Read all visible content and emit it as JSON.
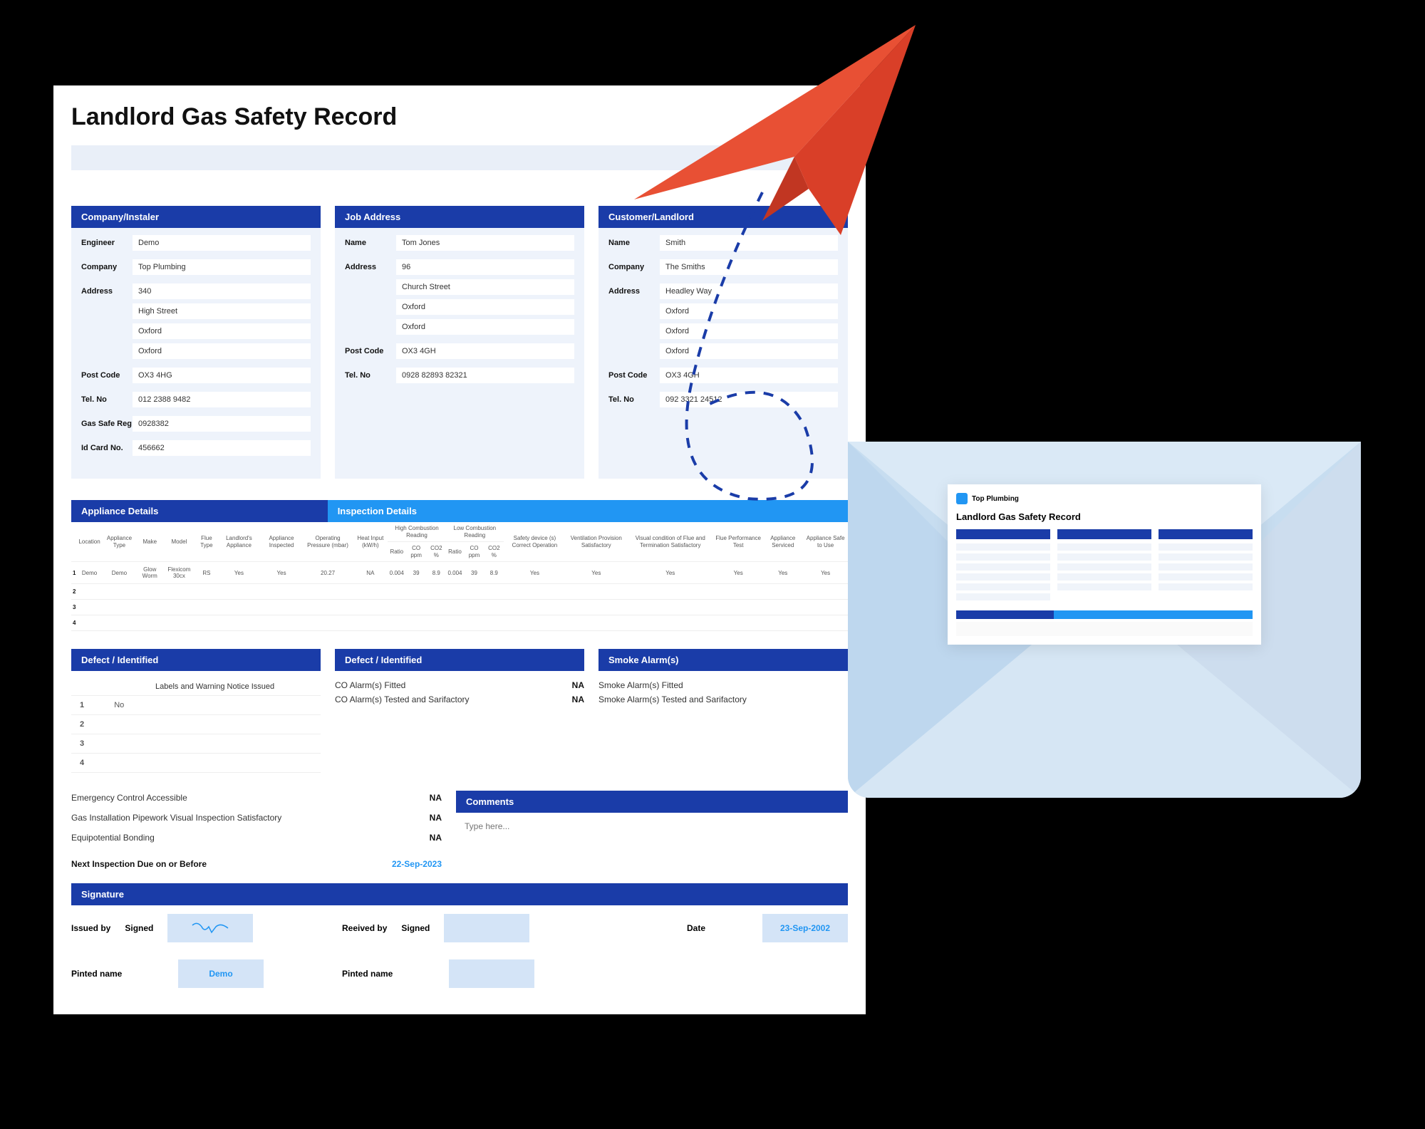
{
  "title": "Landlord Gas Safety Record",
  "panels": {
    "company": {
      "header": "Company/Instaler",
      "engineer_label": "Engineer",
      "engineer": "Demo",
      "company_label": "Company",
      "company": "Top Plumbing",
      "address_label": "Address",
      "addr1": "340",
      "addr2": "High Street",
      "addr3": "Oxford",
      "addr4": "Oxford",
      "postcode_label": "Post Code",
      "postcode": "OX3 4HG",
      "tel_label": "Tel. No",
      "tel": "012 2388 9482",
      "gasreg_label": "Gas Safe Reg",
      "gasreg": "0928382",
      "idcard_label": "Id Card No.",
      "idcard": "456662"
    },
    "job": {
      "header": "Job Address",
      "name_label": "Name",
      "name": "Tom Jones",
      "address_label": "Address",
      "addr1": "96",
      "addr2": "Church Street",
      "addr3": "Oxford",
      "addr4": "Oxford",
      "postcode_label": "Post Code",
      "postcode": "OX3 4GH",
      "tel_label": "Tel. No",
      "tel": "0928 82893 82321"
    },
    "customer": {
      "header": "Customer/Landlord",
      "name_label": "Name",
      "name": "Smith",
      "company_label": "Company",
      "company": "The Smiths",
      "address_label": "Address",
      "addr1": "Headley Way",
      "addr2": "Oxford",
      "addr3": "Oxford",
      "addr4": "Oxford",
      "postcode_label": "Post Code",
      "postcode": "OX3 4GH",
      "tel_label": "Tel. No",
      "tel": "092 3321 24512"
    }
  },
  "tables": {
    "appliance_header": "Appliance Details",
    "inspection_header": "Inspection Details",
    "app_cols": [
      "",
      "Location",
      "Appliance Type",
      "Make",
      "Model",
      "Flue Type"
    ],
    "insp_cols": [
      "Landlord's Appliance",
      "Appliance Inspected",
      "Operating Pressure (mbar)",
      "Heat Input (kW/h)",
      "High Combustion Reading",
      "Low Combustion Reading",
      "Safety device (s) Correct Operation",
      "Ventilation Provision Satisfactory",
      "Visual condition of Flue and Termination Satisfactory",
      "Flue Performance Test",
      "Appliance Serviced",
      "Appliance Safe to Use"
    ],
    "sub_cols": [
      "Ratio",
      "CO ppm",
      "CO2 %",
      "Ratio",
      "CO ppm",
      "CO2 %"
    ],
    "rows": [
      {
        "n": "1",
        "loc": "Demo",
        "type": "Demo",
        "make": "Glow Worm",
        "model": "Flexicom 30cx",
        "flue": "RS",
        "land": "Yes",
        "insp": "Yes",
        "op": "20.27",
        "heat": "NA",
        "hr": "0.004",
        "hco": "39",
        "hco2": "8.9",
        "lr": "0.004",
        "lco": "39",
        "lco2": "8.9",
        "safety": "Yes",
        "vent": "Yes",
        "visual": "Yes",
        "flueperf": "Yes",
        "serviced": "Yes",
        "safe": "Yes"
      },
      {
        "n": "2"
      },
      {
        "n": "3"
      },
      {
        "n": "4"
      }
    ]
  },
  "defects": {
    "header1": "Defect / Identified",
    "header2": "Defect / Identified",
    "header3": "Smoke Alarm(s)",
    "labels_col": "Labels and Warning Notice Issued",
    "rows": [
      {
        "n": "1",
        "lab": "No"
      },
      {
        "n": "2",
        "lab": ""
      },
      {
        "n": "3",
        "lab": ""
      },
      {
        "n": "4",
        "lab": ""
      }
    ],
    "co_fitted": "CO Alarm(s) Fitted",
    "co_fitted_v": "NA",
    "co_tested": "CO Alarm(s) Tested and Sarifactory",
    "co_tested_v": "NA",
    "sm_fitted": "Smoke Alarm(s) Fitted",
    "sm_tested": "Smoke Alarm(s) Tested and Sarifactory"
  },
  "checks": {
    "emergency": "Emergency Control Accessible",
    "emergency_v": "NA",
    "gas_inst": "Gas Installation Pipework Visual Inspection Satisfactory",
    "gas_inst_v": "NA",
    "equip": "Equipotential Bonding",
    "equip_v": "NA",
    "next_label": "Next Inspection Due on or Before",
    "next_date": "22-Sep-2023"
  },
  "comments": {
    "header": "Comments",
    "placeholder": "Type here..."
  },
  "signature": {
    "header": "Signature",
    "issued_by": "Issued by",
    "signed": "Signed",
    "received_by": "Reeived by",
    "date_label": "Date",
    "date": "23-Sep-2002",
    "printed_label": "Pinted name",
    "printed_name": "Demo"
  },
  "mini": {
    "company": "Top Plumbing",
    "title": "Landlord Gas Safety Record"
  }
}
